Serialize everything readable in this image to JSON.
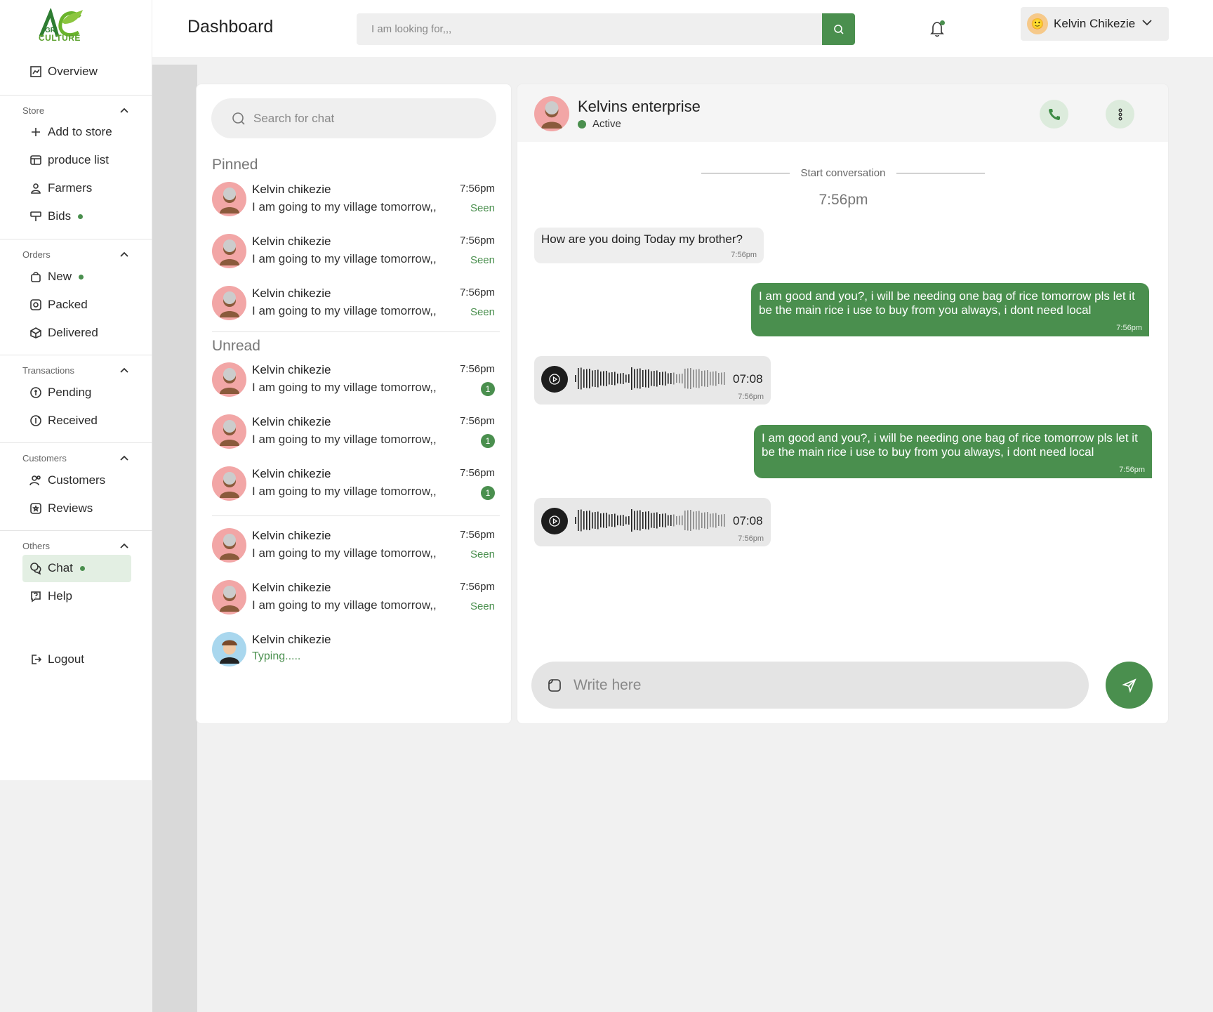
{
  "brand": {
    "logo_text": "CULTURE",
    "logo_mark": "AGRI"
  },
  "sidebar": {
    "overview": "Overview",
    "sections": [
      {
        "label": "Store",
        "items": [
          "Add to store",
          "produce list",
          "Farmers",
          "Bids"
        ]
      },
      {
        "label": "Orders",
        "items": [
          "New",
          "Packed",
          "Delivered"
        ]
      },
      {
        "label": "Transactions",
        "items": [
          "Pending",
          "Received"
        ]
      },
      {
        "label": "Customers",
        "items": [
          "Customers",
          "Reviews"
        ]
      },
      {
        "label": "Others",
        "items": [
          "Chat",
          "Help"
        ]
      }
    ],
    "logout": "Logout"
  },
  "header": {
    "title": "Dashboard",
    "search_placeholder": "I am looking for,,,",
    "user_name": "Kelvin Chikezie"
  },
  "chat_list": {
    "search_placeholder": "Search for chat",
    "pinned_label": "Pinned",
    "unread_label": "Unread",
    "pinned": [
      {
        "name": "Kelvin chikezie",
        "message": "I am going to my village tomorrow,,",
        "time": "7:56pm",
        "status": "Seen"
      },
      {
        "name": "Kelvin chikezie",
        "message": "I am going to my village tomorrow,,",
        "time": "7:56pm",
        "status": "Seen"
      },
      {
        "name": "Kelvin chikezie",
        "message": "I am going to my village tomorrow,,",
        "time": "7:56pm",
        "status": "Seen"
      }
    ],
    "unread": [
      {
        "name": "Kelvin chikezie",
        "message": "I am going to my village tomorrow,,",
        "time": "7:56pm",
        "count": "1"
      },
      {
        "name": "Kelvin chikezie",
        "message": "I am going to my village tomorrow,,",
        "time": "7:56pm",
        "count": "1"
      },
      {
        "name": "Kelvin chikezie",
        "message": "I am going to my village tomorrow,,",
        "time": "7:56pm",
        "count": "1"
      }
    ],
    "others": [
      {
        "name": "Kelvin chikezie",
        "message": "I am going to my village tomorrow,,",
        "time": "7:56pm",
        "status": "Seen"
      },
      {
        "name": "Kelvin chikezie",
        "message": "I am going to my village tomorrow,,",
        "time": "7:56pm",
        "status": "Seen"
      },
      {
        "name": "Kelvin chikezie",
        "typing": "Typing....."
      }
    ]
  },
  "conversation": {
    "name": "Kelvins enterprise",
    "status": "Active",
    "start_label": "Start conversation",
    "start_time": "7:56pm",
    "messages": [
      {
        "type": "incoming",
        "text": "How are you doing Today my brother?",
        "time": "7:56pm"
      },
      {
        "type": "outgoing",
        "text": "I  am good and you?, i will be needing one bag of rice tomorrow  pls let it be the main rice i use to buy from you always, i dont need local",
        "time": "7:56pm"
      },
      {
        "type": "voice",
        "duration": "07:08",
        "time": "7:56pm"
      },
      {
        "type": "outgoing",
        "text": "I  am good and you?, i will be needing one bag of rice tomorrow  pls let it be the main rice i use to buy from you always, i dont need local",
        "time": "7:56pm"
      },
      {
        "type": "voice",
        "duration": "07:08",
        "time": "7:56pm"
      }
    ],
    "composer_placeholder": "Write here"
  },
  "colors": {
    "accent": "#4a8f4e",
    "avatar_bg": "#f2a6a6"
  }
}
